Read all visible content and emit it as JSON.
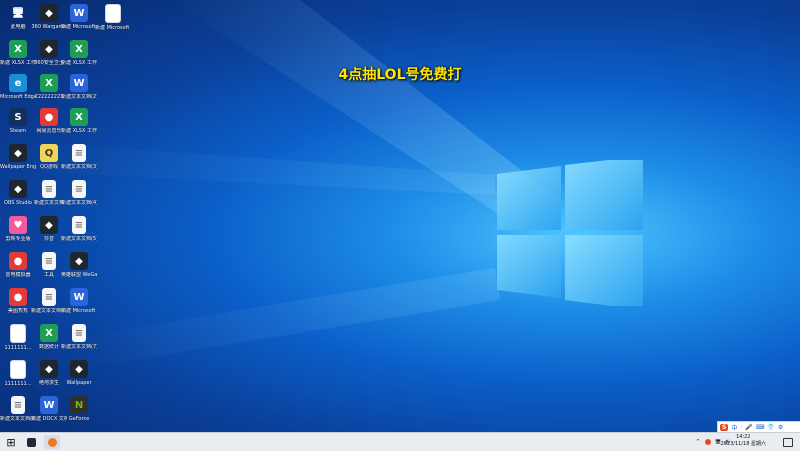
{
  "overlay": {
    "title": "4点抽LOL号免费打"
  },
  "desktop_icons": [
    {
      "label": "此电脑",
      "kind": "pc"
    },
    {
      "label": "360 Wargame",
      "kind": "app"
    },
    {
      "label": "新建 Microsoft Word",
      "kind": "word"
    },
    {
      "label": "新建 Microsoft Word (2)",
      "kind": "doc"
    },
    {
      "label": "新建 XLSX 工作表",
      "kind": "xls"
    },
    {
      "label": "360安全卫士",
      "kind": "app"
    },
    {
      "label": "新建 XLSX 工作表(2)",
      "kind": "xls"
    },
    {
      "label": "Microsoft Edge",
      "kind": "edge"
    },
    {
      "label": "222222223",
      "kind": "xls"
    },
    {
      "label": "新建文本文档(2)",
      "kind": "word"
    },
    {
      "label": "Steam",
      "kind": "steam"
    },
    {
      "label": "网易云音乐",
      "kind": "red"
    },
    {
      "label": "新建 XLSX 工作表(3)",
      "kind": "xls"
    },
    {
      "label": "Wallpaper Engine",
      "kind": "app"
    },
    {
      "label": "QQ游戏",
      "kind": "ylw"
    },
    {
      "label": "新建文本文档(3)",
      "kind": "txt"
    },
    {
      "label": "OBS Studio",
      "kind": "app"
    },
    {
      "label": "新建文本文档",
      "kind": "txt"
    },
    {
      "label": "新建文本文档(4)",
      "kind": "txt"
    },
    {
      "label": "剪映专业版",
      "kind": "pink"
    },
    {
      "label": "抖音",
      "kind": "app"
    },
    {
      "label": "新建文本文档(5)",
      "kind": "txt"
    },
    {
      "label": "雷电模拟器",
      "kind": "red"
    },
    {
      "label": "工具",
      "kind": "txt"
    },
    {
      "label": "英雄联盟 WeGame版",
      "kind": "app"
    },
    {
      "label": "美图秀秀",
      "kind": "red"
    },
    {
      "label": "新建文本文档(6)",
      "kind": "txt"
    },
    {
      "label": "新建 Microsoft Word (3)",
      "kind": "word"
    },
    {
      "label": "1111111...",
      "kind": "doc"
    },
    {
      "label": "数据统计",
      "kind": "xls"
    },
    {
      "label": "新建文本文档(7)",
      "kind": "txt"
    },
    {
      "label": "1111111...",
      "kind": "doc"
    },
    {
      "label": "绝地求生",
      "kind": "app"
    },
    {
      "label": "Wallpaper",
      "kind": "app"
    },
    {
      "label": "新建文本文档(8)",
      "kind": "txt"
    },
    {
      "label": "新建 DOCX 文档(2)",
      "kind": "word"
    },
    {
      "label": "GeForce",
      "kind": "nv"
    }
  ],
  "taskbar": {
    "start_label": "⊞",
    "ime": [
      "S",
      "中",
      "·",
      "🎤",
      "⌨",
      "👕",
      "⚙"
    ],
    "time": "14:22",
    "date": "2023/11/18 星期六",
    "tray_up": "^",
    "volume": "🔊",
    "network": "🖥"
  }
}
